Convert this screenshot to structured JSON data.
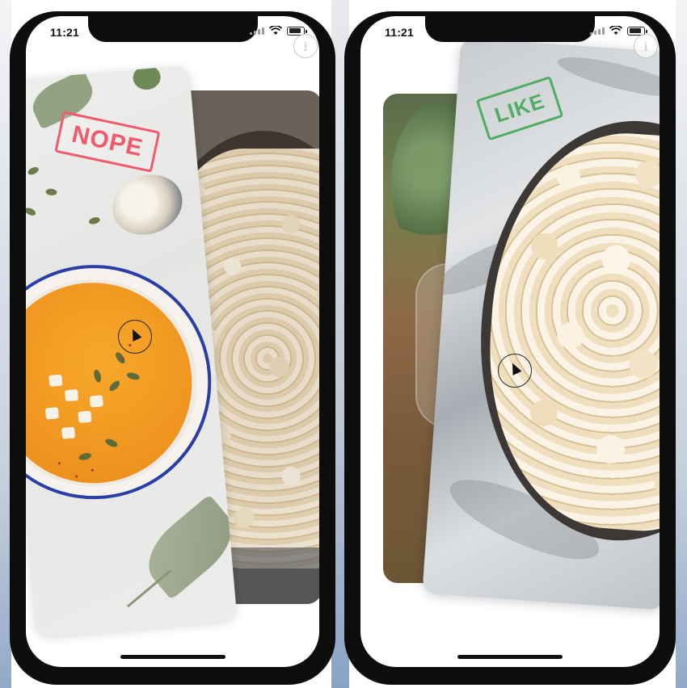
{
  "screens": [
    {
      "status": {
        "time": "11:21"
      },
      "info_button": "i",
      "swipe_stamp": "NOPE",
      "front_card": "soup",
      "back_card": "popcorn"
    },
    {
      "status": {
        "time": "11:21"
      },
      "info_button": "i",
      "swipe_stamp": "LIKE",
      "front_card": "popcorn",
      "back_card": "salad-jar"
    }
  ],
  "colors": {
    "nope": "#ef5b6c",
    "like": "#4fae64",
    "bowl_rim": "#2a3ea8",
    "soup": "#f19a22"
  },
  "icons": [
    "signal-icon",
    "wifi-icon",
    "battery-icon",
    "info-icon",
    "cursor-icon"
  ]
}
